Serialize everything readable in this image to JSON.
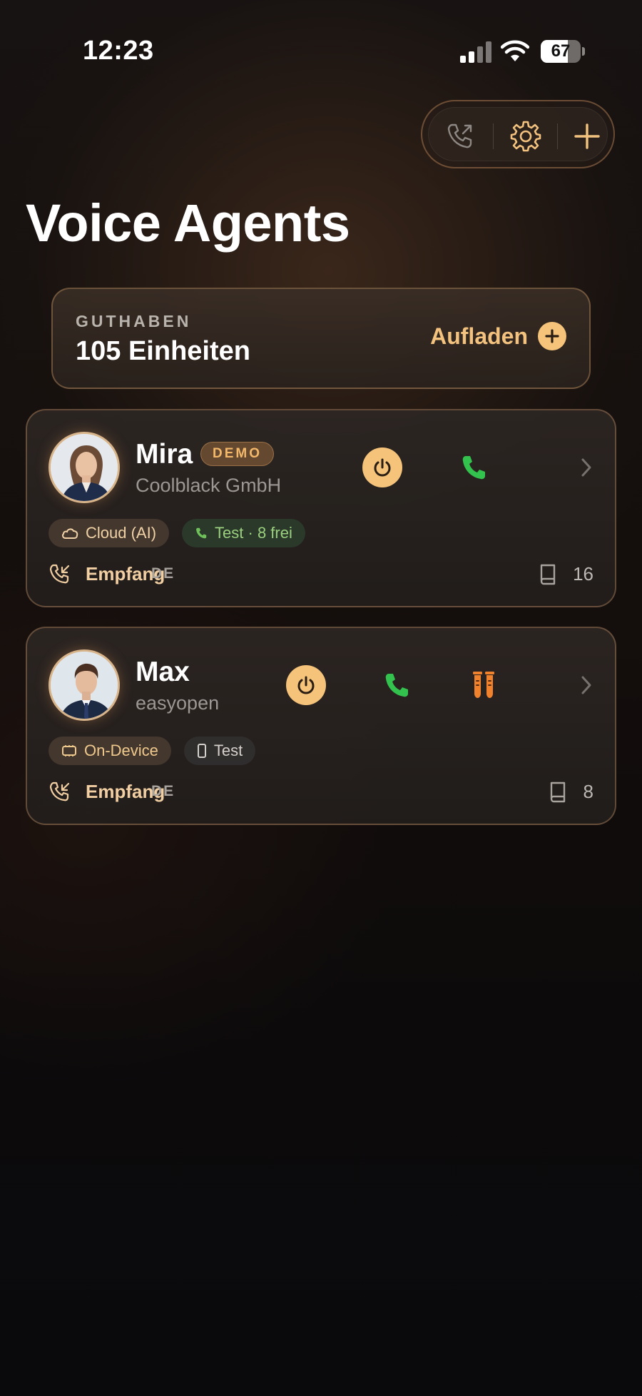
{
  "status_bar": {
    "time": "12:23",
    "battery": "67",
    "battery_level": 0.67
  },
  "toolbar": {
    "buttons": [
      {
        "icon": "call-forward-icon"
      },
      {
        "icon": "gear-icon"
      },
      {
        "icon": "plus-icon"
      }
    ]
  },
  "page": {
    "title": "Voice Agents"
  },
  "balance": {
    "label": "GUTHABEN",
    "value": "105 Einheiten",
    "action": "Aufladen"
  },
  "agents": [
    {
      "name": "Mira",
      "company": "Coolblack GmbH",
      "badge": "DEMO",
      "chips": [
        "Cloud (AI)",
        "Test · 8 frei"
      ],
      "mode": "Empfang",
      "language": "DE",
      "knowledge_count": "16",
      "colors": {
        "power": "#f5c379",
        "call": "#33c24d"
      }
    },
    {
      "name": "Max",
      "company": "easyopen",
      "chips": [
        "On-Device",
        "Test"
      ],
      "mode": "Empfang",
      "language": "DE",
      "knowledge_count": "8",
      "colors": {
        "power": "#f5c379",
        "call": "#33c24d",
        "test_tube": "#f0822e"
      }
    }
  ]
}
